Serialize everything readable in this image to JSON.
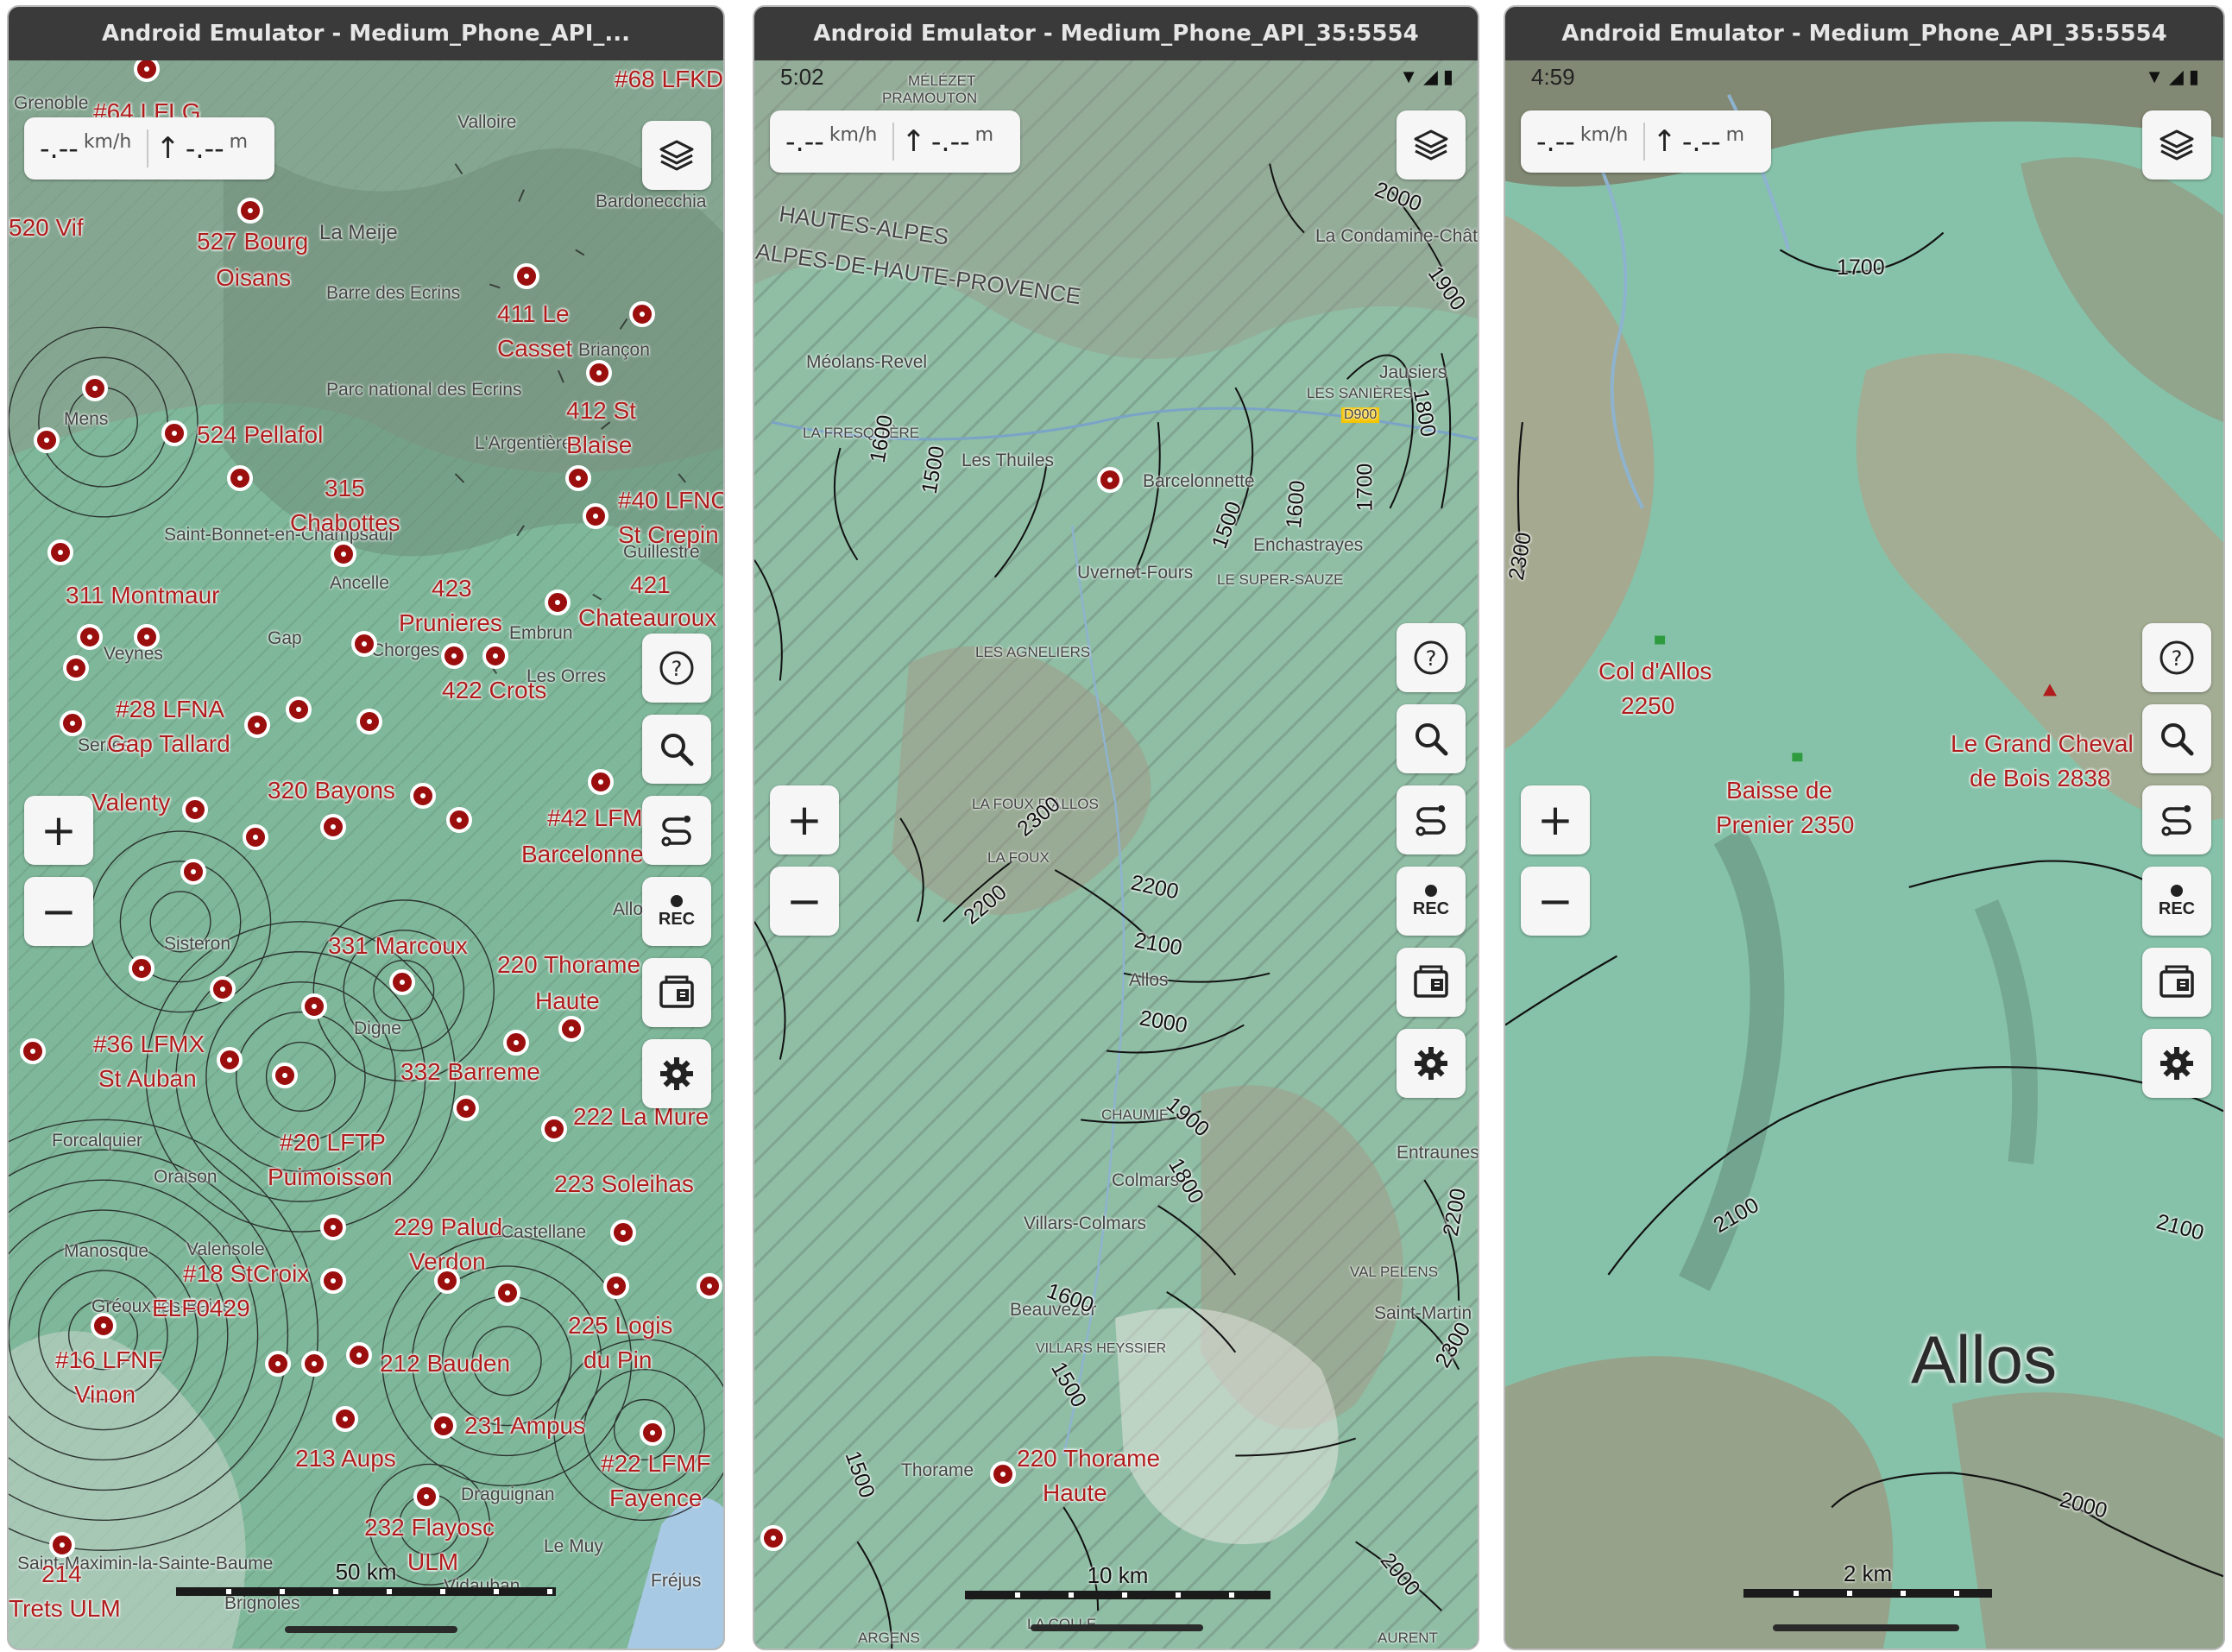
{
  "windows": [
    {
      "title": "Android Emulator - Medium_Phone_API_...",
      "speed_value": "-.--",
      "speed_unit": "km/h",
      "alt_arrow": "↑",
      "alt_value": "-.--",
      "alt_unit": "m",
      "scale_label": "50 km",
      "labels_red": [
        "#64 LFLG",
        "527 Bourg",
        "Oisans",
        "411 Le",
        "Casset",
        "412 St",
        "Blaise",
        "524 Pellafol",
        "315",
        "Chabottes",
        "#40 LFNC",
        "St Crepin",
        "423",
        "Prunieres",
        "421",
        "Chateauroux",
        "311 Montmaur",
        "422 Crots",
        "#28 LFNA",
        "Gap Tallard",
        "320 Bayons",
        "#42 LFM",
        "Barcelonnette",
        "331 Marcoux",
        "220 Thorame",
        "Haute",
        "#36 LFMX",
        "St Auban",
        "332 Barreme",
        "#20 LFTP",
        "Puimoisson",
        "222 La Mure",
        "223 Soleihas",
        "229 Palud",
        "Verdon",
        "#18 StCroix",
        "ELF0429",
        "225 Logis",
        "du Pin",
        "#16 LFNF",
        "Vinon",
        "212 Bauden",
        "231 Ampus",
        "213 Aups",
        "#22 LFMF",
        "Fayence",
        "232 Flayosc",
        "ULM",
        "214",
        "Trets ULM",
        "520 Vif",
        "#68 LFKD",
        "Valenty"
      ],
      "labels_gray": [
        "Grenoble",
        "Valloire",
        "La Meije",
        "Barre des Ecrins",
        "Parc national des Ecrins",
        "Mens",
        "L'Argentière",
        "Saint-Bonnet-en-Champsaur",
        "Ancelle",
        "Gap",
        "Veynes",
        "Serres",
        "Sisteron",
        "Digne",
        "Forcalquier",
        "Oraison",
        "Manosque",
        "Valensole",
        "Castellane",
        "Gréoux-les-Bains",
        "Draguignan",
        "Le Muy",
        "Fréjus",
        "Saint-Maximin-la-Sainte-Baume",
        "Brignoles",
        "Vidauban",
        "Bardonecchia",
        "Briançon",
        "Guillestre",
        "Les Orres",
        "Allos",
        "Embrun",
        "Chorges"
      ]
    },
    {
      "title": "Android Emulator - Medium_Phone_API_35:5554",
      "time": "5:02",
      "speed_value": "-.--",
      "speed_unit": "km/h",
      "alt_arrow": "↑",
      "alt_value": "-.--",
      "alt_unit": "m",
      "scale_label": "10 km",
      "labels_red": [
        "220 Thorame",
        "Haute"
      ],
      "labels_gray": [
        "HAUTES-ALPES",
        "ALPES-DE-HAUTE-PROVENCE",
        "Méolans-Revel",
        "LA FRESQUIÈRE",
        "Les Thuiles",
        "Barcelonnette",
        "Uvernet-Fours",
        "Enchastrayes",
        "LE SUPER-SAUZE",
        "La Condamine-Châtelard",
        "Jausiers",
        "LES SANIÈRES",
        "LES AGNELIERS",
        "LA FOUX D'ALLOS",
        "LA FOUX",
        "Allos",
        "CHAUMIE",
        "Colmars",
        "Villars-Colmars",
        "Entraunes",
        "VAL PELENS",
        "Saint-Martin",
        "Beauvezer",
        "VILLARS HEYSSIER",
        "Thorame",
        "MÉLÉZET",
        "PRAMOUTON",
        "LA COLLE",
        "ARGENS",
        "AURENT",
        "D900"
      ],
      "contours": [
        "2000",
        "1900",
        "1800",
        "1700",
        "1600",
        "1500",
        "1600",
        "1500",
        "1700",
        "2300",
        "2200",
        "2200",
        "2100",
        "2000",
        "1900",
        "1800",
        "1600",
        "1500",
        "2200",
        "2300",
        "2000",
        "1500",
        "1500"
      ]
    },
    {
      "title": "Android Emulator - Medium_Phone_API_35:5554",
      "time": "4:59",
      "speed_value": "-.--",
      "speed_unit": "km/h",
      "alt_arrow": "↑",
      "alt_value": "-.--",
      "alt_unit": "m",
      "scale_label": "2 km",
      "labels_peaks": [
        "Col d'Allos",
        "2250",
        "Le Grand Cheval",
        "de Bois 2838",
        "Baisse de",
        "Prenier 2350"
      ],
      "labels_big": [
        "Allos"
      ],
      "contours": [
        "1700",
        "2300",
        "2100",
        "2100",
        "2000"
      ]
    }
  ],
  "buttons": {
    "layers": "layers-icon",
    "help": "?",
    "search": "search-icon",
    "route": "route-icon",
    "rec": "REC",
    "offline_maps": "offline-maps-icon",
    "settings": "gear-icon",
    "zoom_in": "+",
    "zoom_out": "−"
  }
}
